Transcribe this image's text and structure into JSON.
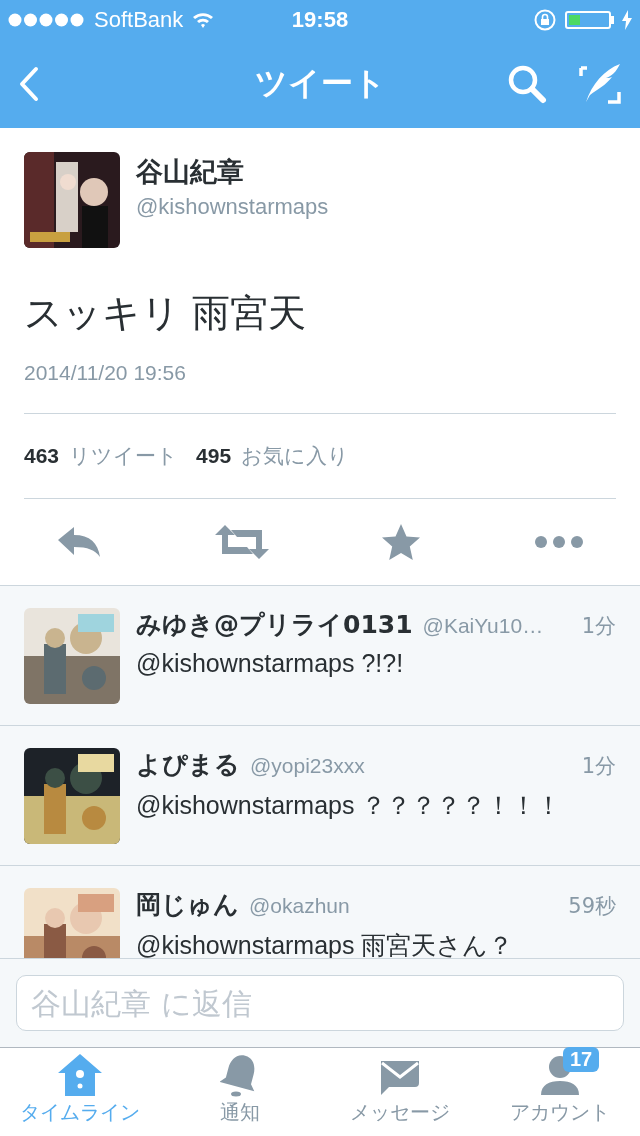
{
  "status_bar": {
    "carrier": "SoftBank",
    "time": "19:58",
    "battery": {
      "level": 0.3
    }
  },
  "nav": {
    "title": "ツイート"
  },
  "tweet": {
    "name": "谷山紀章",
    "handle": "@kishownstarmaps",
    "text": "スッキリ 雨宮天",
    "date": "2014/11/20 19:56",
    "retweets": "463",
    "retweets_label": "リツイート",
    "favorites": "495",
    "favorites_label": "お気に入り"
  },
  "replies": [
    {
      "name": "みゆき@プリライ0131",
      "handle": "@KaiYu10…",
      "time": "1分",
      "text": "@kishownstarmaps ?!?!"
    },
    {
      "name": "よぴまる",
      "handle": "@yopi23xxx",
      "time": "1分",
      "text": "@kishownstarmaps ？？？？？！！！"
    },
    {
      "name": "岡じゅん",
      "handle": "@okazhun",
      "time": "59秒",
      "text": "@kishownstarmaps 雨宮天さん？"
    }
  ],
  "reply_box": {
    "placeholder": "谷山紀章 に返信"
  },
  "tabs": [
    {
      "kind": "home",
      "label": "タイムライン",
      "selected": true
    },
    {
      "kind": "bell",
      "label": "通知",
      "selected": false
    },
    {
      "kind": "mail",
      "label": "メッセージ",
      "selected": false
    },
    {
      "kind": "person",
      "label": "アカウント",
      "selected": false,
      "badge": "17"
    }
  ]
}
